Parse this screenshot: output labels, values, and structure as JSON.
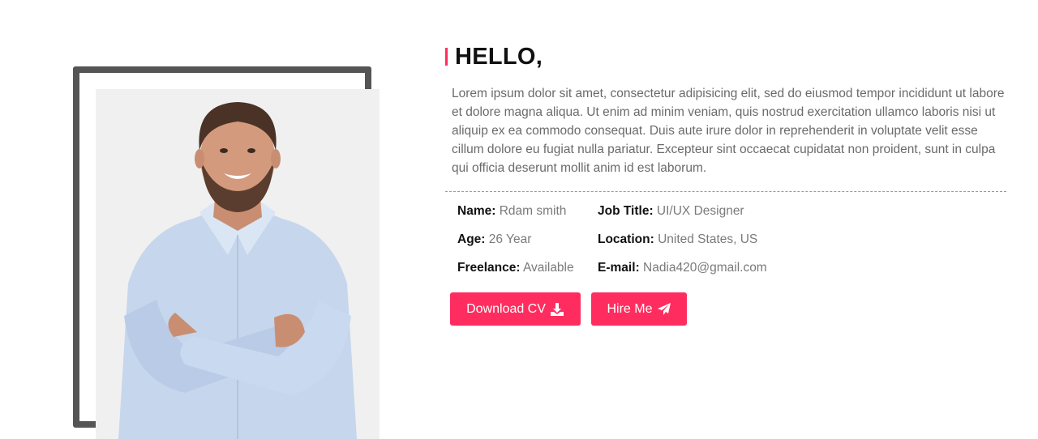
{
  "about": {
    "heading": "HELLO,",
    "bio": "Lorem ipsum dolor sit amet, consectetur adipisicing elit, sed do eiusmod tempor incididunt ut labore et dolore magna aliqua. Ut enim ad minim veniam, quis nostrud exercitation ullamco laboris nisi ut aliquip ex ea commodo consequat. Duis aute irure dolor in reprehenderit in voluptate velit esse cillum dolore eu fugiat nulla pariatur. Excepteur sint occaecat cupidatat non proident, sunt in culpa qui officia deserunt mollit anim id est laborum.",
    "info": [
      {
        "label": "Name:",
        "value": "Rdam smith"
      },
      {
        "label": "Job Title:",
        "value": "UI/UX Designer"
      },
      {
        "label": "Age:",
        "value": "26 Year"
      },
      {
        "label": "Location:",
        "value": "United States, US"
      },
      {
        "label": "Freelance:",
        "value": "Available"
      },
      {
        "label": "E-mail:",
        "value": "Nadia420@gmail.com"
      }
    ],
    "buttons": {
      "download_label": "Download CV",
      "download_icon": "download-icon",
      "hire_label": "Hire Me",
      "hire_icon": "paper-plane-icon"
    }
  },
  "colors": {
    "accent": "#ff2d5f",
    "frame": "#555555",
    "heading": "#111111",
    "body_text": "#6a6a6a"
  }
}
